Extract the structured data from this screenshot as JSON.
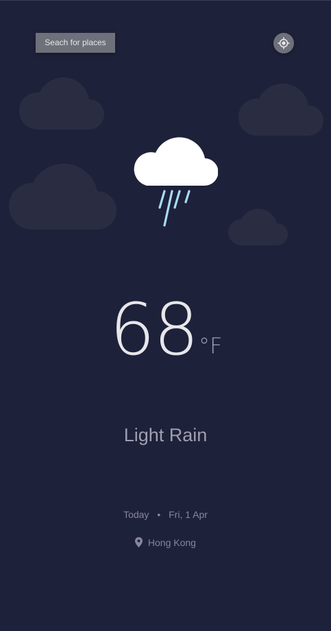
{
  "search": {
    "button_label": "Seach for places"
  },
  "locate": {
    "icon": "gps-crosshair-icon"
  },
  "weather": {
    "icon": "light-rain-icon",
    "temperature": "68",
    "unit": "°F",
    "condition": "Light Rain"
  },
  "date": {
    "day_label": "Today",
    "separator": "•",
    "date_text": "Fri, 1 Apr"
  },
  "location": {
    "icon": "map-pin-icon",
    "name": "Hong Kong"
  },
  "colors": {
    "background": "#1e213a",
    "button": "#6e707a",
    "text_primary": "#e7e7eb",
    "text_secondary": "#a09fb1",
    "text_muted": "#88869d",
    "rain": "#a8dcf5"
  }
}
